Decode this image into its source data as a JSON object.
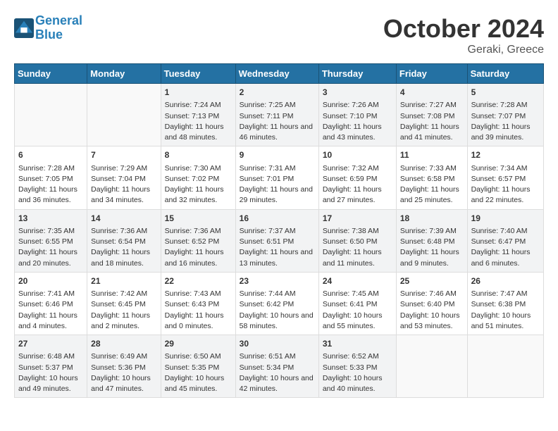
{
  "header": {
    "logo_line1": "General",
    "logo_line2": "Blue",
    "month": "October 2024",
    "location": "Geraki, Greece"
  },
  "weekdays": [
    "Sunday",
    "Monday",
    "Tuesday",
    "Wednesday",
    "Thursday",
    "Friday",
    "Saturday"
  ],
  "weeks": [
    [
      {
        "day": "",
        "content": ""
      },
      {
        "day": "",
        "content": ""
      },
      {
        "day": "1",
        "content": "Sunrise: 7:24 AM\nSunset: 7:13 PM\nDaylight: 11 hours and 48 minutes."
      },
      {
        "day": "2",
        "content": "Sunrise: 7:25 AM\nSunset: 7:11 PM\nDaylight: 11 hours and 46 minutes."
      },
      {
        "day": "3",
        "content": "Sunrise: 7:26 AM\nSunset: 7:10 PM\nDaylight: 11 hours and 43 minutes."
      },
      {
        "day": "4",
        "content": "Sunrise: 7:27 AM\nSunset: 7:08 PM\nDaylight: 11 hours and 41 minutes."
      },
      {
        "day": "5",
        "content": "Sunrise: 7:28 AM\nSunset: 7:07 PM\nDaylight: 11 hours and 39 minutes."
      }
    ],
    [
      {
        "day": "6",
        "content": "Sunrise: 7:28 AM\nSunset: 7:05 PM\nDaylight: 11 hours and 36 minutes."
      },
      {
        "day": "7",
        "content": "Sunrise: 7:29 AM\nSunset: 7:04 PM\nDaylight: 11 hours and 34 minutes."
      },
      {
        "day": "8",
        "content": "Sunrise: 7:30 AM\nSunset: 7:02 PM\nDaylight: 11 hours and 32 minutes."
      },
      {
        "day": "9",
        "content": "Sunrise: 7:31 AM\nSunset: 7:01 PM\nDaylight: 11 hours and 29 minutes."
      },
      {
        "day": "10",
        "content": "Sunrise: 7:32 AM\nSunset: 6:59 PM\nDaylight: 11 hours and 27 minutes."
      },
      {
        "day": "11",
        "content": "Sunrise: 7:33 AM\nSunset: 6:58 PM\nDaylight: 11 hours and 25 minutes."
      },
      {
        "day": "12",
        "content": "Sunrise: 7:34 AM\nSunset: 6:57 PM\nDaylight: 11 hours and 22 minutes."
      }
    ],
    [
      {
        "day": "13",
        "content": "Sunrise: 7:35 AM\nSunset: 6:55 PM\nDaylight: 11 hours and 20 minutes."
      },
      {
        "day": "14",
        "content": "Sunrise: 7:36 AM\nSunset: 6:54 PM\nDaylight: 11 hours and 18 minutes."
      },
      {
        "day": "15",
        "content": "Sunrise: 7:36 AM\nSunset: 6:52 PM\nDaylight: 11 hours and 16 minutes."
      },
      {
        "day": "16",
        "content": "Sunrise: 7:37 AM\nSunset: 6:51 PM\nDaylight: 11 hours and 13 minutes."
      },
      {
        "day": "17",
        "content": "Sunrise: 7:38 AM\nSunset: 6:50 PM\nDaylight: 11 hours and 11 minutes."
      },
      {
        "day": "18",
        "content": "Sunrise: 7:39 AM\nSunset: 6:48 PM\nDaylight: 11 hours and 9 minutes."
      },
      {
        "day": "19",
        "content": "Sunrise: 7:40 AM\nSunset: 6:47 PM\nDaylight: 11 hours and 6 minutes."
      }
    ],
    [
      {
        "day": "20",
        "content": "Sunrise: 7:41 AM\nSunset: 6:46 PM\nDaylight: 11 hours and 4 minutes."
      },
      {
        "day": "21",
        "content": "Sunrise: 7:42 AM\nSunset: 6:45 PM\nDaylight: 11 hours and 2 minutes."
      },
      {
        "day": "22",
        "content": "Sunrise: 7:43 AM\nSunset: 6:43 PM\nDaylight: 11 hours and 0 minutes."
      },
      {
        "day": "23",
        "content": "Sunrise: 7:44 AM\nSunset: 6:42 PM\nDaylight: 10 hours and 58 minutes."
      },
      {
        "day": "24",
        "content": "Sunrise: 7:45 AM\nSunset: 6:41 PM\nDaylight: 10 hours and 55 minutes."
      },
      {
        "day": "25",
        "content": "Sunrise: 7:46 AM\nSunset: 6:40 PM\nDaylight: 10 hours and 53 minutes."
      },
      {
        "day": "26",
        "content": "Sunrise: 7:47 AM\nSunset: 6:38 PM\nDaylight: 10 hours and 51 minutes."
      }
    ],
    [
      {
        "day": "27",
        "content": "Sunrise: 6:48 AM\nSunset: 5:37 PM\nDaylight: 10 hours and 49 minutes."
      },
      {
        "day": "28",
        "content": "Sunrise: 6:49 AM\nSunset: 5:36 PM\nDaylight: 10 hours and 47 minutes."
      },
      {
        "day": "29",
        "content": "Sunrise: 6:50 AM\nSunset: 5:35 PM\nDaylight: 10 hours and 45 minutes."
      },
      {
        "day": "30",
        "content": "Sunrise: 6:51 AM\nSunset: 5:34 PM\nDaylight: 10 hours and 42 minutes."
      },
      {
        "day": "31",
        "content": "Sunrise: 6:52 AM\nSunset: 5:33 PM\nDaylight: 10 hours and 40 minutes."
      },
      {
        "day": "",
        "content": ""
      },
      {
        "day": "",
        "content": ""
      }
    ]
  ]
}
